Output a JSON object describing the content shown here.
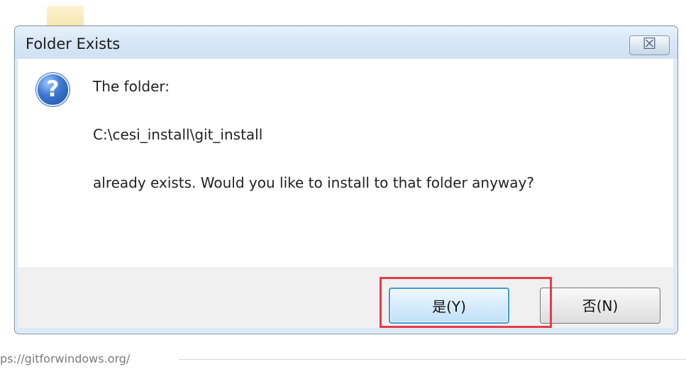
{
  "dialog": {
    "title": "Folder Exists",
    "close_symbol": "☒",
    "message_lines": [
      "The folder:",
      "C:\\cesi_install\\git_install",
      "already exists. Would you like to install to that folder anyway?"
    ],
    "icon": "question-icon",
    "buttons": {
      "yes": "是(Y)",
      "no": "否(N)"
    }
  },
  "background": {
    "url_text": "ps://gitforwindows.org/"
  },
  "colors": {
    "title_bar": "#d8e7f7",
    "footer": "#f0f0f0",
    "highlight": "#e53c49",
    "yes_border": "#3d9bdc"
  }
}
